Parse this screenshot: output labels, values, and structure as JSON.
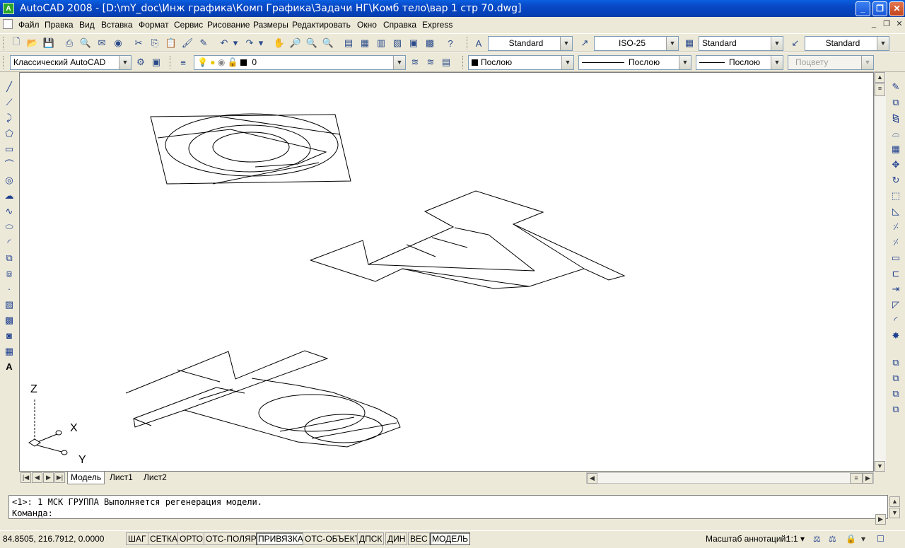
{
  "window": {
    "app_icon": "A",
    "title": "AutoCAD 2008 - [D:\\mY_doc\\Инж графика\\Комп Графика\\Задачи НГ\\Комб тело\\вар 1 стр 70.dwg]",
    "minimize": "_",
    "maximize": "❐",
    "close": "✕"
  },
  "menu": {
    "items": [
      "Файл",
      "Правка",
      "Вид",
      "Вставка",
      "Формат",
      "Сервис",
      "Рисование",
      "Размеры",
      "Редактировать",
      "Окно",
      "Справка",
      "Express"
    ],
    "doc_minimize": "_",
    "doc_restore": "❐",
    "doc_close": "✕"
  },
  "toolbar1": {
    "text_style": "Standard",
    "dim_style": "ISO-25",
    "table_style": "Standard",
    "multileader_style": "Standard"
  },
  "toolbar2": {
    "workspace": "Классический AutoCAD",
    "layer": "0",
    "color": "Послою",
    "linetype": "Послою",
    "lineweight": "Послою",
    "plotstyle": "Поцвету"
  },
  "ucs": {
    "z": "Z",
    "x": "X",
    "y": "Y"
  },
  "layout_tabs": [
    "Модель",
    "Лист1",
    "Лист2"
  ],
  "command": {
    "history": "<1>: 1 МСК ГРУППА Выполняется регенерация модели.",
    "prompt": "Команда:"
  },
  "status": {
    "coords": "84.8505,  216.7912, 0.0000",
    "toggles": [
      "ШАГ",
      "СЕТКА",
      "ОРТО",
      "ОТС-ПОЛЯР",
      "ПРИВЯЗКА",
      "ОТС-ОБЪЕКТ",
      "ДПСК",
      "ДИН",
      "ВЕС",
      "МОДЕЛЬ"
    ],
    "active_toggles": [
      "ПРИВЯЗКА",
      "МОДЕЛЬ"
    ],
    "annotation_scale_label": "Масштаб аннотаций:",
    "annotation_scale": "1:1"
  }
}
